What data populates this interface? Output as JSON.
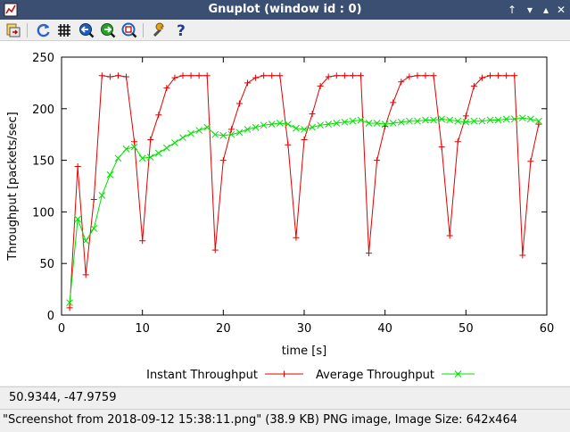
{
  "window": {
    "title": "Gnuplot (window id : 0)",
    "titlebar_color": "#3b4f73"
  },
  "toolbar": {
    "tools": [
      "export-icon",
      "replot-icon",
      "grid-icon",
      "zoom-previous-icon",
      "zoom-next-icon",
      "autoscale-icon",
      "config-icon",
      "help-icon"
    ]
  },
  "coords": {
    "text": "50.9344, -47.9759"
  },
  "status": {
    "text": "\"Screenshot from 2018-09-12 15:38:11.png\" (38.9 KB) PNG image, Image Size: 642x464"
  },
  "chart_data": {
    "type": "line",
    "xlabel": "time [s]",
    "ylabel": "Throughput [packets/sec]",
    "xlim": [
      0,
      60
    ],
    "ylim": [
      0,
      250
    ],
    "xticks": [
      0,
      10,
      20,
      30,
      40,
      50,
      60
    ],
    "yticks": [
      0,
      50,
      100,
      150,
      200,
      250
    ],
    "grid": false,
    "legend_position": "bottom",
    "series": [
      {
        "name": "Instant Throughput",
        "color": "#e00000",
        "marker": "+",
        "x": [
          1,
          2,
          3,
          4,
          5,
          6,
          7,
          8,
          9,
          10,
          11,
          12,
          13,
          14,
          15,
          16,
          17,
          18,
          19,
          20,
          21,
          22,
          23,
          24,
          25,
          26,
          27,
          28,
          29,
          30,
          31,
          32,
          33,
          34,
          35,
          36,
          37,
          38,
          39,
          40,
          41,
          42,
          43,
          44,
          45,
          46,
          47,
          48,
          49,
          50,
          51,
          52,
          53,
          54,
          55,
          56,
          57,
          58,
          59
        ],
        "y": [
          7,
          144,
          39,
          112,
          232,
          231,
          232,
          231,
          168,
          72,
          170,
          194,
          220,
          230,
          232,
          232,
          232,
          232,
          63,
          150,
          180,
          205,
          225,
          230,
          232,
          232,
          232,
          165,
          75,
          170,
          195,
          222,
          231,
          232,
          232,
          232,
          232,
          60,
          150,
          183,
          206,
          226,
          231,
          232,
          232,
          232,
          163,
          77,
          168,
          193,
          222,
          230,
          232,
          232,
          232,
          232,
          58,
          149,
          185
        ]
      },
      {
        "name": "Average Throughput",
        "color": "#00e000",
        "marker": "x",
        "x": [
          1,
          2,
          3,
          4,
          5,
          6,
          7,
          8,
          9,
          10,
          11,
          12,
          13,
          14,
          15,
          16,
          17,
          18,
          19,
          20,
          21,
          22,
          23,
          24,
          25,
          26,
          27,
          28,
          29,
          30,
          31,
          32,
          33,
          34,
          35,
          36,
          37,
          38,
          39,
          40,
          41,
          42,
          43,
          44,
          45,
          46,
          47,
          48,
          49,
          50,
          51,
          52,
          53,
          54,
          55,
          56,
          57,
          58,
          59
        ],
        "y": [
          12,
          93,
          72,
          84,
          116,
          136,
          152,
          161,
          163,
          152,
          153,
          157,
          162,
          167,
          172,
          176,
          179,
          182,
          175,
          174,
          175,
          177,
          180,
          182,
          184,
          185,
          186,
          185,
          181,
          180,
          182,
          184,
          185,
          186,
          187,
          188,
          189,
          186,
          186,
          185,
          186,
          187,
          188,
          188,
          189,
          189,
          190,
          189,
          188,
          187,
          188,
          188,
          189,
          189,
          190,
          190,
          191,
          190,
          188
        ]
      }
    ]
  }
}
